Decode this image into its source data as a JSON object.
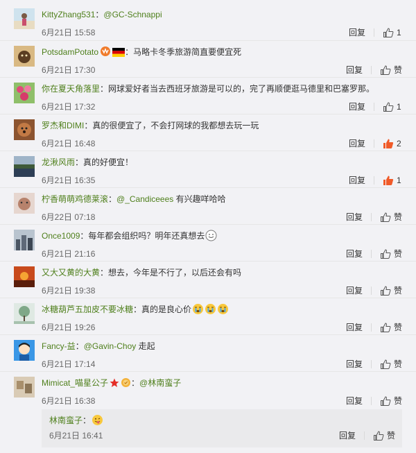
{
  "comments": [
    {
      "name": "KittyZhang531",
      "mention": "@GC-Schnappi",
      "text": "",
      "time": "6月21日 15:58",
      "reply_label": "回复",
      "likes": "1",
      "liked": false,
      "avatar": "avatar-beach"
    },
    {
      "name": "PotsdamPotato",
      "badges": [
        "vip-badge-icon",
        "germany-flag-icon"
      ],
      "mention": "",
      "text": "马略卡冬季旅游简直要便宜死",
      "time": "6月21日 17:30",
      "reply_label": "回复",
      "likes": "赞",
      "liked": false,
      "avatar": "avatar-cat"
    },
    {
      "name": "你在夏天角落里",
      "mention": "",
      "text": "网球爱好者当去西班牙旅游是可以的，完了再顺便逛马德里和巴塞罗那。",
      "time": "6月21日 17:32",
      "reply_label": "回复",
      "likes": "1",
      "liked": false,
      "avatar": "avatar-flowers"
    },
    {
      "name": "罗杰和DIMI",
      "mention": "",
      "text": "真的很便宜了，不会打网球的我都想去玩一玩",
      "time": "6月21日 16:48",
      "reply_label": "回复",
      "likes": "2",
      "liked": true,
      "avatar": "avatar-dog"
    },
    {
      "name": "龙湫风雨",
      "mention": "",
      "text": "真的好便宜！",
      "time": "6月21日 16:35",
      "reply_label": "回复",
      "likes": "1",
      "liked": true,
      "avatar": "avatar-lake"
    },
    {
      "name": "柠香萌萌鸡德莱滚",
      "mention": "@_Candiceees",
      "text": "有兴趣咩哈哈",
      "time": "6月22日 07:18",
      "reply_label": "回复",
      "likes": "赞",
      "liked": false,
      "avatar": "avatar-pet"
    },
    {
      "name": "Once1009",
      "mention": "",
      "text": "每年都会组织吗？明年还真想去",
      "emojis": [
        "smile-emoji-icon"
      ],
      "time": "6月21日 21:16",
      "reply_label": "回复",
      "likes": "赞",
      "liked": false,
      "avatar": "avatar-city"
    },
    {
      "name": "又大又黄的大黄",
      "mention": "",
      "text": "想去，今年是不行了，以后还会有吗",
      "time": "6月21日 19:38",
      "reply_label": "回复",
      "likes": "赞",
      "liked": false,
      "avatar": "avatar-sunset"
    },
    {
      "name": "冰糖葫芦五加皮不要冰糖",
      "mention": "",
      "text": "真的是良心价",
      "emojis": [
        "crying-emoji-icon",
        "crying-emoji-icon",
        "crying-emoji-icon"
      ],
      "time": "6月21日 19:26",
      "reply_label": "回复",
      "likes": "赞",
      "liked": false,
      "avatar": "avatar-tree"
    },
    {
      "name": "Fancy-益",
      "mention": "@Gavin-Choy",
      "text": "走起",
      "time": "6月21日 17:14",
      "reply_label": "回复",
      "likes": "赞",
      "liked": false,
      "avatar": "avatar-cartoon"
    },
    {
      "name": "Mimicat_喵星公子",
      "badges": [
        "star-badge-icon",
        "medal-badge-icon"
      ],
      "mention": "@林南蛮子",
      "text": "",
      "time": "6月21日 16:38",
      "reply_label": "回复",
      "likes": "赞",
      "liked": false,
      "avatar": "avatar-room"
    }
  ],
  "subreply": {
    "name": "林南蛮子",
    "text": "",
    "emojis": [
      "tongue-emoji-icon"
    ],
    "time": "6月21日 16:41",
    "reply_label": "回复",
    "likes": "赞"
  },
  "colors": {
    "name": "#4e7f1b",
    "liked": "#f05a28",
    "icon": "#555555"
  }
}
